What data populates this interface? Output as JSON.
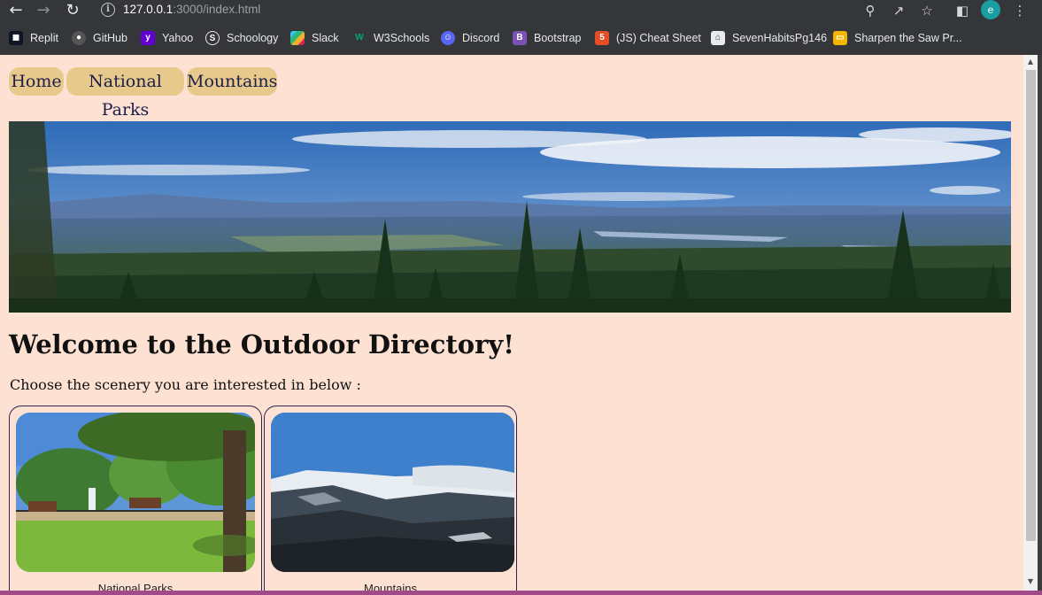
{
  "browser": {
    "url_host": "127.0.0.1",
    "url_path": ":3000/index.html",
    "avatar_letter": "e",
    "bookmarks": [
      {
        "label": "Replit",
        "icon": "replit-icon",
        "color": "#f26207"
      },
      {
        "label": "GitHub",
        "icon": "github-icon",
        "color": "#555555"
      },
      {
        "label": "Yahoo",
        "icon": "yahoo-icon",
        "color": "#6001d2"
      },
      {
        "label": "Schoology",
        "icon": "schoology-icon",
        "color": "#3a3a3a"
      },
      {
        "label": "Slack",
        "icon": "slack-icon",
        "color": "#e01e5a"
      },
      {
        "label": "W3Schools",
        "icon": "w3schools-icon",
        "color": "#04aa6d"
      },
      {
        "label": "Discord",
        "icon": "discord-icon",
        "color": "#5865f2"
      },
      {
        "label": "Bootstrap",
        "icon": "bootstrap-icon",
        "color": "#7952b3"
      },
      {
        "label": "(JS) Cheat Sheet",
        "icon": "html5-icon",
        "color": "#e44d26"
      },
      {
        "label": "SevenHabitsPg146",
        "icon": "library-icon",
        "color": "#dddddd"
      },
      {
        "label": "Sharpen the Saw Pr...",
        "icon": "slides-icon",
        "color": "#f4b400"
      }
    ]
  },
  "page": {
    "nav": [
      "Home",
      "National Parks",
      "Mountains"
    ],
    "heading": "Welcome to the Outdoor Directory!",
    "intro": "Choose the scenery you are interested in below :",
    "cards": [
      {
        "label": "National Parks"
      },
      {
        "label": "Mountains"
      }
    ],
    "colors": {
      "page_bg": "#fde1d2",
      "nav_pill": "#e7c98b",
      "nav_text": "#1d1d4a",
      "card_border": "#2a2353"
    }
  }
}
